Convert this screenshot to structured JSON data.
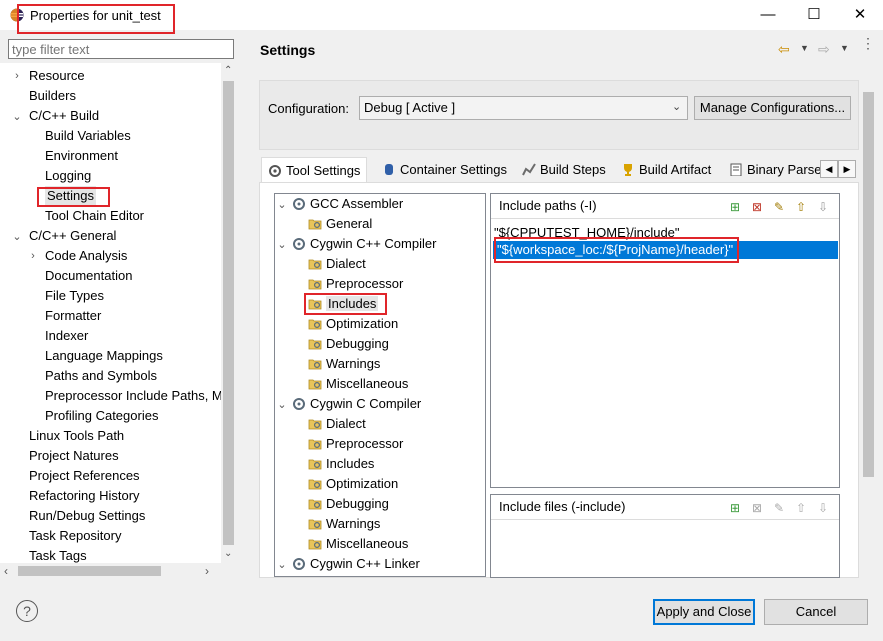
{
  "window": {
    "title": "Properties for unit_test",
    "minimize_glyph": "—",
    "maximize_glyph": "☐",
    "close_glyph": "✕"
  },
  "filter": {
    "placeholder": "type filter text"
  },
  "nav": [
    {
      "label": "Resource",
      "level": 0,
      "toggle": "›"
    },
    {
      "label": "Builders",
      "level": 0,
      "toggle": ""
    },
    {
      "label": "C/C++ Build",
      "level": 0,
      "toggle": "⌄"
    },
    {
      "label": "Build Variables",
      "level": 1,
      "toggle": ""
    },
    {
      "label": "Environment",
      "level": 1,
      "toggle": ""
    },
    {
      "label": "Logging",
      "level": 1,
      "toggle": ""
    },
    {
      "label": "Settings",
      "level": 1,
      "toggle": "",
      "selected": true
    },
    {
      "label": "Tool Chain Editor",
      "level": 1,
      "toggle": ""
    },
    {
      "label": "C/C++ General",
      "level": 0,
      "toggle": "⌄"
    },
    {
      "label": "Code Analysis",
      "level": 1,
      "toggle": "›"
    },
    {
      "label": "Documentation",
      "level": 1,
      "toggle": ""
    },
    {
      "label": "File Types",
      "level": 1,
      "toggle": ""
    },
    {
      "label": "Formatter",
      "level": 1,
      "toggle": ""
    },
    {
      "label": "Indexer",
      "level": 1,
      "toggle": ""
    },
    {
      "label": "Language Mappings",
      "level": 1,
      "toggle": ""
    },
    {
      "label": "Paths and Symbols",
      "level": 1,
      "toggle": ""
    },
    {
      "label": "Preprocessor Include Paths, M",
      "level": 1,
      "toggle": ""
    },
    {
      "label": "Profiling Categories",
      "level": 1,
      "toggle": ""
    },
    {
      "label": "Linux Tools Path",
      "level": 0,
      "toggle": ""
    },
    {
      "label": "Project Natures",
      "level": 0,
      "toggle": ""
    },
    {
      "label": "Project References",
      "level": 0,
      "toggle": ""
    },
    {
      "label": "Refactoring History",
      "level": 0,
      "toggle": ""
    },
    {
      "label": "Run/Debug Settings",
      "level": 0,
      "toggle": ""
    },
    {
      "label": "Task Repository",
      "level": 0,
      "toggle": ""
    },
    {
      "label": "Task Tags",
      "level": 0,
      "toggle": ""
    }
  ],
  "header": {
    "title": "Settings"
  },
  "configuration": {
    "label": "Configuration:",
    "value": "Debug  [ Active ]",
    "manage_button": "Manage Configurations..."
  },
  "tabs": [
    "Tool Settings",
    "Container Settings",
    "Build Steps",
    "Build Artifact",
    "Binary Parse"
  ],
  "tool_tree": [
    {
      "label": "GCC Assembler",
      "level": 0,
      "toggle": "⌄"
    },
    {
      "label": "General",
      "level": 1,
      "toggle": ""
    },
    {
      "label": "Cygwin C++ Compiler",
      "level": 0,
      "toggle": "⌄"
    },
    {
      "label": "Dialect",
      "level": 1,
      "toggle": ""
    },
    {
      "label": "Preprocessor",
      "level": 1,
      "toggle": ""
    },
    {
      "label": "Includes",
      "level": 1,
      "toggle": "",
      "selected": true
    },
    {
      "label": "Optimization",
      "level": 1,
      "toggle": ""
    },
    {
      "label": "Debugging",
      "level": 1,
      "toggle": ""
    },
    {
      "label": "Warnings",
      "level": 1,
      "toggle": ""
    },
    {
      "label": "Miscellaneous",
      "level": 1,
      "toggle": ""
    },
    {
      "label": "Cygwin C Compiler",
      "level": 0,
      "toggle": "⌄"
    },
    {
      "label": "Dialect",
      "level": 1,
      "toggle": ""
    },
    {
      "label": "Preprocessor",
      "level": 1,
      "toggle": ""
    },
    {
      "label": "Includes",
      "level": 1,
      "toggle": ""
    },
    {
      "label": "Optimization",
      "level": 1,
      "toggle": ""
    },
    {
      "label": "Debugging",
      "level": 1,
      "toggle": ""
    },
    {
      "label": "Warnings",
      "level": 1,
      "toggle": ""
    },
    {
      "label": "Miscellaneous",
      "level": 1,
      "toggle": ""
    },
    {
      "label": "Cygwin C++ Linker",
      "level": 0,
      "toggle": "⌄"
    }
  ],
  "include_paths": {
    "title": "Include paths (-I)",
    "items": [
      "\"${CPPUTEST_HOME}/include\"",
      "\"${workspace_loc:/${ProjName}/header}\""
    ]
  },
  "include_files": {
    "title": "Include files (-include)"
  },
  "footer": {
    "help_glyph": "?",
    "apply_close": "Apply and Close",
    "cancel": "Cancel"
  },
  "colors": {
    "selection": "#0078d7",
    "highlight_box": "#e0252a"
  }
}
